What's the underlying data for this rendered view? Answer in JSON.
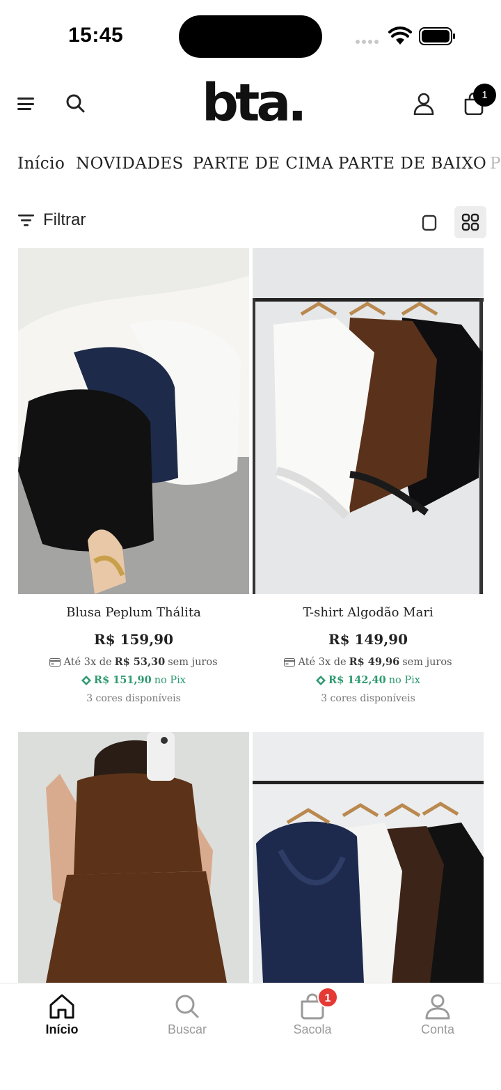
{
  "status_bar": {
    "time": "15:45"
  },
  "header": {
    "logo": "bta.",
    "cart_count": "1"
  },
  "categories": [
    "Início",
    "NOVIDADES",
    "PARTE DE CIMA",
    "PARTE DE BAIXO",
    "P"
  ],
  "filter": {
    "label": "Filtrar"
  },
  "products": [
    {
      "name": "Blusa Peplum Thálita",
      "price": "R$ 159,90",
      "installments_prefix": "Até 3x de",
      "installment_value": "R$ 53,30",
      "installments_suffix": "sem juros",
      "pix_value": "R$ 151,90",
      "pix_suffix": "no Pix",
      "colors": "3 cores disponíveis"
    },
    {
      "name": "T-shirt Algodão Mari",
      "price": "R$ 149,90",
      "installments_prefix": "Até 3x de",
      "installment_value": "R$ 49,96",
      "installments_suffix": "sem juros",
      "pix_value": "R$ 142,40",
      "pix_suffix": "no Pix",
      "colors": "3 cores disponíveis"
    }
  ],
  "tab_bar": {
    "tabs": [
      {
        "label": "Início",
        "icon": "home-icon",
        "active": true
      },
      {
        "label": "Buscar",
        "icon": "search-icon",
        "active": false
      },
      {
        "label": "Sacola",
        "icon": "bag-icon",
        "active": false
      },
      {
        "label": "Conta",
        "icon": "user-icon",
        "active": false
      }
    ],
    "bag_badge": "1"
  },
  "colors": {
    "pix_green": "#2e9a6f",
    "badge_red": "#e53935",
    "active_tab": "#111111",
    "inactive_tab": "#9a9a9a"
  }
}
